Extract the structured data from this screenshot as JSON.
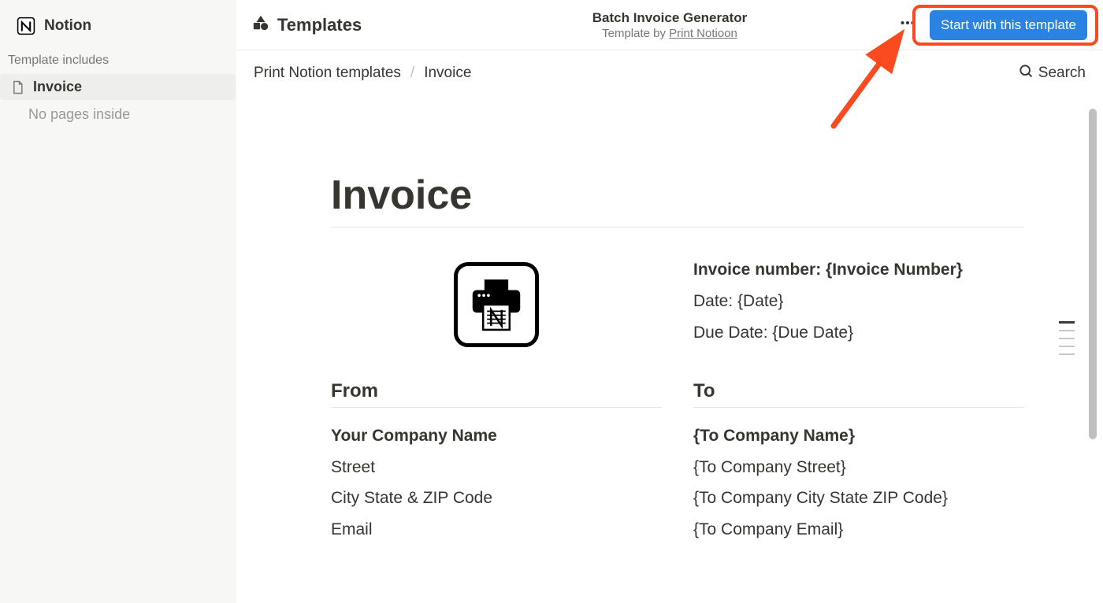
{
  "brand": {
    "name": "Notion"
  },
  "sidebar": {
    "section_label": "Template includes",
    "items": [
      {
        "label": "Invoice"
      }
    ],
    "empty_text": "No pages inside"
  },
  "top_header": {
    "templates_label": "Templates",
    "title": "Batch Invoice Generator",
    "byline_prefix": "Template by ",
    "byline_link": "Print Notioon",
    "cta_label": "Start with this template"
  },
  "subheader": {
    "breadcrumb": {
      "root": "Print Notion templates",
      "sep": "/",
      "current": "Invoice"
    },
    "search_label": "Search"
  },
  "page": {
    "title": "Invoice",
    "meta": {
      "number_label": "Invoice number: {Invoice Number}",
      "date_label": "Date: {Date}",
      "due_label": "Due Date: {Due Date}"
    },
    "from": {
      "header": "From",
      "company": "Your Company Name",
      "street": "Street",
      "city": "City State & ZIP Code",
      "email": "Email"
    },
    "to": {
      "header": "To",
      "company": "{To Company Name}",
      "street": "{To Company Street}",
      "city": "{To Company City State ZIP Code}",
      "email": "{To Company Email}"
    }
  }
}
